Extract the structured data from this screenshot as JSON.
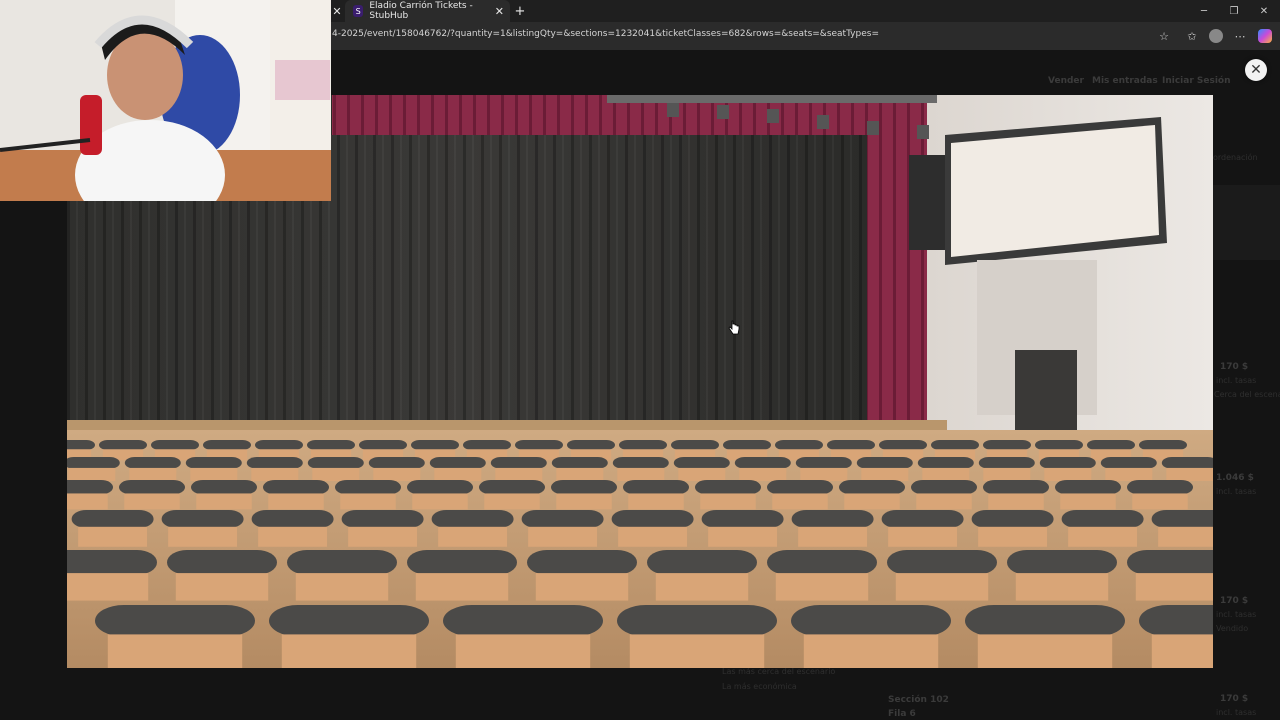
{
  "browser": {
    "active_tab_title": "Eladio Carrión Tickets - StubHub",
    "active_tab_favicon": "S",
    "url": "4-2025/event/158046762/?quantity=1&listingQty=&sections=1232041&ticketClasses=682&rows=&seats=&seatTypes="
  },
  "background_page": {
    "header_links": [
      "Vender",
      "Mis entradas",
      "Iniciar Sesión"
    ],
    "sidebar_label": "ordenación",
    "listings": [
      {
        "price": "170 $",
        "note": "incl. tasas",
        "extra": "Cerca del escenario"
      },
      {
        "price": "1.046 $",
        "note": "incl. tasas",
        "extra": ""
      },
      {
        "price": "170 $",
        "note": "incl. tasas",
        "extra": "Vendido"
      },
      {
        "price": "170 $",
        "note": "incl. tasas",
        "extra": ""
      }
    ],
    "legend": [
      "Las más cerca del escenario",
      "La más económica"
    ],
    "bottom_section": {
      "title": "Sección 102",
      "row": "Fila 6"
    }
  },
  "colors": {
    "curtain_red": "#8a2a48",
    "curtain_dark": "#333331",
    "seat_tan": "#d9a577",
    "seat_frame": "#4b4a48",
    "stage_floor": "#c9a47c",
    "screen": "#f1ebe4"
  }
}
